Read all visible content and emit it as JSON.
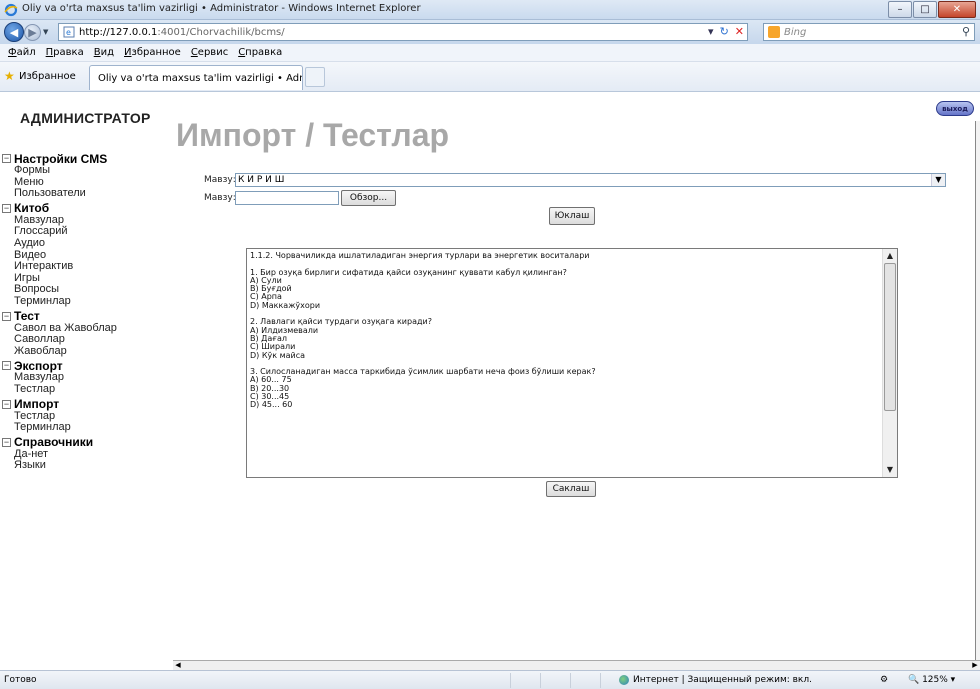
{
  "window": {
    "title": "Oliy va o'rta maxsus ta'lim vazirligi • Administrator - Windows Internet Explorer",
    "controls": [
      "–",
      "□",
      "✕"
    ]
  },
  "navigation": {
    "url_host": "http://127.0.0.1",
    "url_rest": ":4001/Chorvachilik/bcms/",
    "search_placeholder": "Bing"
  },
  "menu": [
    "Файл",
    "Правка",
    "Вид",
    "Избранное",
    "Сервис",
    "Справка"
  ],
  "favorites": {
    "label": "Избранное",
    "tab_title": "Oliy va o'rta maxsus ta'lim vazirligi • Administrator"
  },
  "sidebar": {
    "header": "АДМИНИСТРАТОР",
    "sections": [
      {
        "label": "Настройки CMS",
        "items": [
          "Формы",
          "Меню",
          "Пользователи"
        ]
      },
      {
        "label": "Китоб",
        "items": [
          "Мавзулар",
          "Глоссарий",
          "Аудио",
          "Видео",
          "Интерактив",
          "Игры",
          "Вопросы",
          "Терминлар"
        ]
      },
      {
        "label": "Тест",
        "items": [
          "Савол ва Жавоблар",
          "Саволлар",
          "Жавоблар"
        ]
      },
      {
        "label": "Экспорт",
        "items": [
          "Мавзулар",
          "Тестлар"
        ]
      },
      {
        "label": "Импорт",
        "items": [
          "Тестлар",
          "Терминлар"
        ]
      },
      {
        "label": "Справочники",
        "items": [
          "Да-нет",
          "Языки"
        ]
      }
    ]
  },
  "main": {
    "title": "Импорт / Тестлар",
    "logout_label": "выход",
    "topic_label": "Мавзу:",
    "topic_value": "К И Р И Ш",
    "file_label": "Мавзу:",
    "browse_label": "Обзор...",
    "upload_label": "Юклаш",
    "save_label": "Саклаш",
    "textarea_lines": [
      "1.1.2. Чорвачиликда ишлатиладиган энергия турлари ва энергетик воситалари",
      "",
      "1. Бир озуқа бирлиги сифатида қайси озуқанинг қуввати кабул қилинган?",
      "A) Сули",
      "B) Буғдой",
      "C) Арпа",
      "D) Маккажўхори",
      "",
      "2. Лавлаги қайси турдаги озуқага киради?",
      "A) Илдизмевали",
      "B) Дағал",
      "C) Ширали",
      "D) Кўк майса",
      "",
      "3. Силосланадиган масса таркибида ўсимлик шарбати неча фоиз бўлиши керак?",
      "A) 60... 75",
      "B) 20...30",
      "C) 30...45",
      "D) 45... 60"
    ]
  },
  "status": {
    "ready": "Готово",
    "zone": "Интернет | Защищенный режим: вкл.",
    "zoom": "125%"
  }
}
